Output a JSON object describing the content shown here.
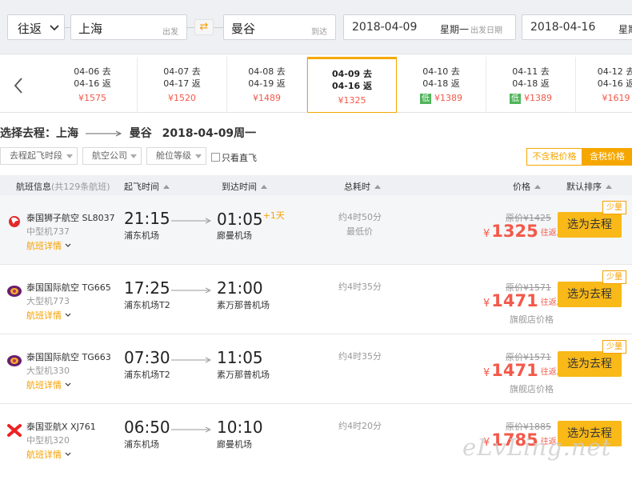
{
  "search": {
    "trip_type": "往返",
    "from_city": "上海",
    "from_hint": "出发",
    "to_city": "曼谷",
    "to_hint": "到达",
    "depart_date": "2018-04-09",
    "depart_weekday": "星期一",
    "depart_hint": "出发日期",
    "return_date": "2018-04-16",
    "return_weekday": "星期"
  },
  "date_bar": [
    {
      "go": "04-06 去",
      "back": "04-16 返",
      "price": "¥1575",
      "low": ""
    },
    {
      "go": "04-07 去",
      "back": "04-17 返",
      "price": "¥1520",
      "low": ""
    },
    {
      "go": "04-08 去",
      "back": "04-19 返",
      "price": "¥1489",
      "low": ""
    },
    {
      "go": "04-09 去",
      "back": "04-16 返",
      "price": "¥1325",
      "low": ""
    },
    {
      "go": "04-10 去",
      "back": "04-18 返",
      "price": "¥1389",
      "low": "低"
    },
    {
      "go": "04-11 去",
      "back": "04-18 返",
      "price": "¥1389",
      "low": "低"
    },
    {
      "go": "04-12 去",
      "back": "04-16 返",
      "price": "¥1619",
      "low": ""
    }
  ],
  "route_title": {
    "prefix": "选择去程：上海",
    "dest": "曼谷",
    "date": "2018-04-09周一"
  },
  "filters": {
    "time": "去程起飞时段",
    "airline": "航空公司",
    "cabin": "舱位等级",
    "direct": "只看直飞"
  },
  "tax_toggle": {
    "excl": "不含税价格",
    "incl": "含税价格"
  },
  "table_head": {
    "flight": "航班信息",
    "count": "(共129条航班)",
    "dep": "起飞时间",
    "arr": "到达时间",
    "dur": "总耗时",
    "price": "价格",
    "sort": "默认排序"
  },
  "flights": [
    {
      "airline": "泰国狮子航空 SL8037",
      "plane": "中型机737",
      "detail": "航班详情",
      "dep_time": "21:15",
      "dep_airport": "浦东机场",
      "arr_time": "01:05",
      "plus_day": "+1天",
      "arr_airport": "廊曼机场",
      "duration": "约4时50分",
      "lowest": "最低价",
      "orig_price": "原价¥1425",
      "currency": "¥",
      "price": "1325",
      "note": "往返总价",
      "shop": "",
      "button": "选为去程",
      "tag": "少量"
    },
    {
      "airline": "泰国国际航空 TG665",
      "plane": "大型机773",
      "detail": "航班详情",
      "dep_time": "17:25",
      "dep_airport": "浦东机场T2",
      "arr_time": "21:00",
      "plus_day": "",
      "arr_airport": "素万那普机场",
      "duration": "约4时35分",
      "lowest": "",
      "orig_price": "原价¥1571",
      "currency": "¥",
      "price": "1471",
      "note": "往返总价",
      "shop": "旗舰店价格",
      "button": "选为去程",
      "tag": "少量"
    },
    {
      "airline": "泰国国际航空 TG663",
      "plane": "大型机330",
      "detail": "航班详情",
      "dep_time": "07:30",
      "dep_airport": "浦东机场T2",
      "arr_time": "11:05",
      "plus_day": "",
      "arr_airport": "素万那普机场",
      "duration": "约4时35分",
      "lowest": "",
      "orig_price": "原价¥1571",
      "currency": "¥",
      "price": "1471",
      "note": "往返总价",
      "shop": "旗舰店价格",
      "button": "选为去程",
      "tag": "少量"
    },
    {
      "airline": "泰国亚航X XJ761",
      "plane": "中型机320",
      "detail": "航班详情",
      "dep_time": "06:50",
      "dep_airport": "浦东机场",
      "arr_time": "10:10",
      "plus_day": "",
      "arr_airport": "廊曼机场",
      "duration": "约4时20分",
      "lowest": "",
      "orig_price": "原价¥1885",
      "currency": "¥",
      "price": "1785",
      "note": "往返总价",
      "shop": "",
      "button": "选为去程",
      "tag": ""
    }
  ],
  "watermark": "eLvLing.net",
  "colors": {
    "accent": "#f5a700",
    "button": "#f8b919",
    "price": "#f3594a",
    "low_badge": "#4fb55a"
  }
}
